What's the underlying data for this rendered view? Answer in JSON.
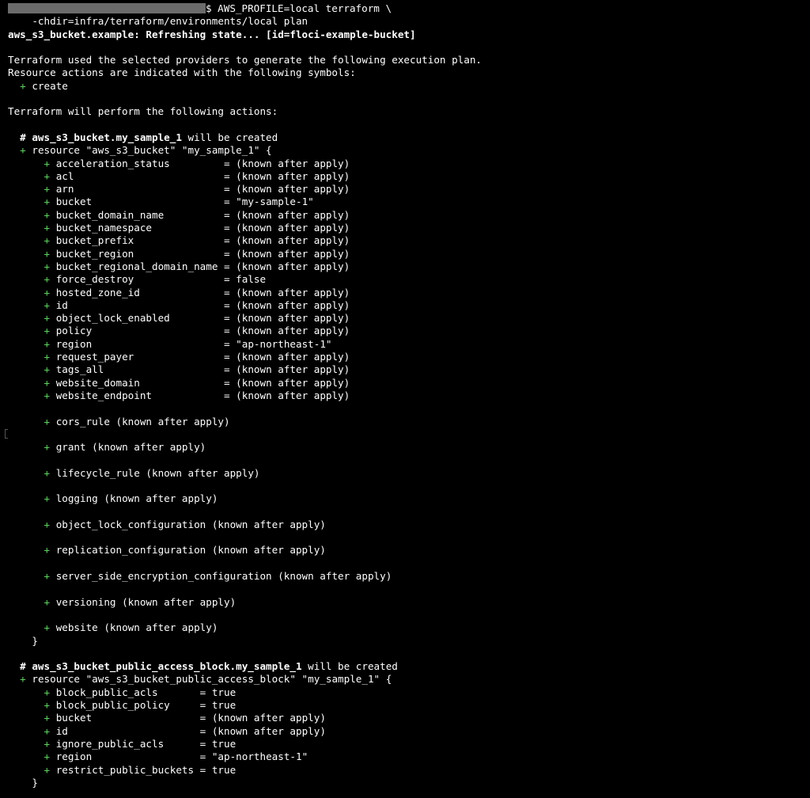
{
  "colors": {
    "background": "#000000",
    "text": "#ffffff",
    "plus_symbol": "#5fd35f",
    "prompt_mask": "#6b6b6b"
  },
  "command": {
    "prompt_suffix": "$ ",
    "line1": "AWS_PROFILE=local terraform \\",
    "line2": "    -chdir=infra/terraform/environments/local plan"
  },
  "refresh_line": "aws_s3_bucket.example: Refreshing state... [id=floci-example-bucket]",
  "intro": {
    "line1": "Terraform used the selected providers to generate the following execution plan.",
    "line2": "Resource actions are indicated with the following symbols:",
    "symbol_plus": "+",
    "symbol_label": "create",
    "perform": "Terraform will perform the following actions:"
  },
  "resources": [
    {
      "comment_hash": "# ",
      "address": "aws_s3_bucket.my_sample_1",
      "will_be": " will be created",
      "declaration": "resource \"aws_s3_bucket\" \"my_sample_1\" {",
      "attributes": [
        {
          "name": "acceleration_status        ",
          "value": "= (known after apply)"
        },
        {
          "name": "acl                        ",
          "value": "= (known after apply)"
        },
        {
          "name": "arn                        ",
          "value": "= (known after apply)"
        },
        {
          "name": "bucket                     ",
          "value": "= \"my-sample-1\""
        },
        {
          "name": "bucket_domain_name         ",
          "value": "= (known after apply)"
        },
        {
          "name": "bucket_namespace           ",
          "value": "= (known after apply)"
        },
        {
          "name": "bucket_prefix              ",
          "value": "= (known after apply)"
        },
        {
          "name": "bucket_region              ",
          "value": "= (known after apply)"
        },
        {
          "name": "bucket_regional_domain_name",
          "value": "= (known after apply)"
        },
        {
          "name": "force_destroy              ",
          "value": "= false"
        },
        {
          "name": "hosted_zone_id             ",
          "value": "= (known after apply)"
        },
        {
          "name": "id                         ",
          "value": "= (known after apply)"
        },
        {
          "name": "object_lock_enabled        ",
          "value": "= (known after apply)"
        },
        {
          "name": "policy                     ",
          "value": "= (known after apply)"
        },
        {
          "name": "region                     ",
          "value": "= \"ap-northeast-1\""
        },
        {
          "name": "request_payer              ",
          "value": "= (known after apply)"
        },
        {
          "name": "tags_all                   ",
          "value": "= (known after apply)"
        },
        {
          "name": "website_domain             ",
          "value": "= (known after apply)"
        },
        {
          "name": "website_endpoint           ",
          "value": "= (known after apply)"
        }
      ],
      "blocks": [
        "cors_rule (known after apply)",
        "grant (known after apply)",
        "lifecycle_rule (known after apply)",
        "logging (known after apply)",
        "object_lock_configuration (known after apply)",
        "replication_configuration (known after apply)",
        "server_side_encryption_configuration (known after apply)",
        "versioning (known after apply)",
        "website (known after apply)"
      ],
      "close": "}"
    },
    {
      "comment_hash": "# ",
      "address": "aws_s3_bucket_public_access_block.my_sample_1",
      "will_be": " will be created",
      "declaration": "resource \"aws_s3_bucket_public_access_block\" \"my_sample_1\" {",
      "attributes": [
        {
          "name": "block_public_acls      ",
          "value": "= true"
        },
        {
          "name": "block_public_policy    ",
          "value": "= true"
        },
        {
          "name": "bucket                 ",
          "value": "= (known after apply)"
        },
        {
          "name": "id                     ",
          "value": "= (known after apply)"
        },
        {
          "name": "ignore_public_acls     ",
          "value": "= true"
        },
        {
          "name": "region                 ",
          "value": "= \"ap-northeast-1\""
        },
        {
          "name": "restrict_public_buckets",
          "value": "= true"
        }
      ],
      "blocks": [],
      "close": "}"
    }
  ]
}
